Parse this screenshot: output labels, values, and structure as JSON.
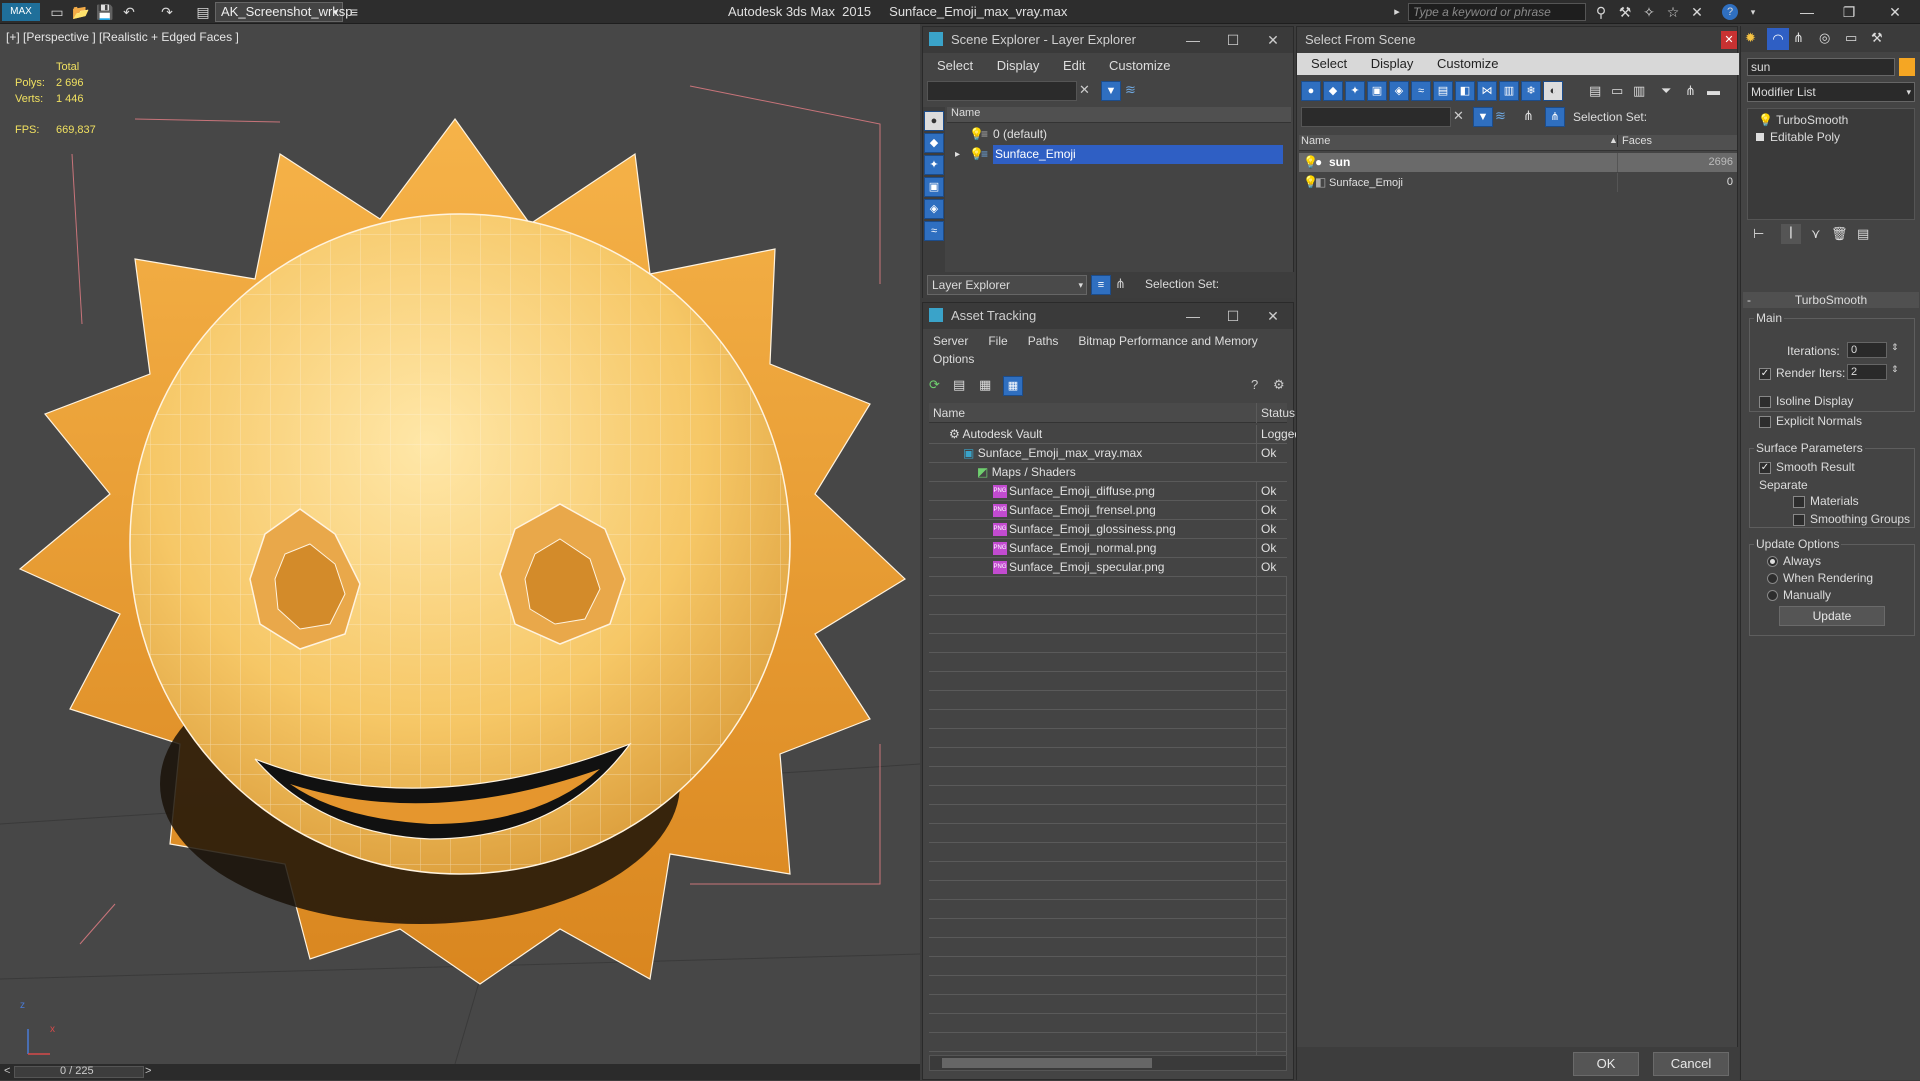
{
  "titlebar": {
    "workspace": "AK_Screenshot_wrksp",
    "app_title": "Autodesk 3ds Max  2015     Sunface_Emoji_max_vray.max",
    "search_placeholder": "Type a keyword or phrase"
  },
  "viewport": {
    "label": "[+] [Perspective ] [Realistic + Edged Faces ]",
    "stats": {
      "total_label": "Total",
      "polys_label": "Polys:",
      "polys_value": "2 696",
      "verts_label": "Verts:",
      "verts_value": "1 446",
      "fps_label": "FPS:",
      "fps_value": "669,837"
    },
    "axis_z": "z",
    "axis_x": "x"
  },
  "timeline": {
    "frame": "0 / 225"
  },
  "scene_explorer": {
    "title": "Scene Explorer - Layer Explorer",
    "menu": [
      "Select",
      "Display",
      "Edit",
      "Customize"
    ],
    "column_name": "Name",
    "layers": [
      {
        "name": "0 (default)",
        "selected": false
      },
      {
        "name": "Sunface_Emoji",
        "selected": true
      }
    ],
    "footer_dropdown": "Layer Explorer",
    "selection_set_label": "Selection Set:"
  },
  "asset_tracking": {
    "title": "Asset Tracking",
    "menu": [
      "Server",
      "File",
      "Paths",
      "Bitmap Performance and Memory"
    ],
    "menu2": "Options",
    "col_name": "Name",
    "col_status": "Status",
    "rows": [
      {
        "name": "Autodesk Vault",
        "status": "Logged",
        "indent": 1,
        "icon": "vault"
      },
      {
        "name": "Sunface_Emoji_max_vray.max",
        "status": "Ok",
        "indent": 2,
        "icon": "max"
      },
      {
        "name": "Maps / Shaders",
        "status": "",
        "indent": 3,
        "icon": "maps"
      },
      {
        "name": "Sunface_Emoji_diffuse.png",
        "status": "Ok",
        "indent": 4,
        "icon": "png"
      },
      {
        "name": "Sunface_Emoji_frensel.png",
        "status": "Ok",
        "indent": 4,
        "icon": "png"
      },
      {
        "name": "Sunface_Emoji_glossiness.png",
        "status": "Ok",
        "indent": 4,
        "icon": "png"
      },
      {
        "name": "Sunface_Emoji_normal.png",
        "status": "Ok",
        "indent": 4,
        "icon": "png"
      },
      {
        "name": "Sunface_Emoji_specular.png",
        "status": "Ok",
        "indent": 4,
        "icon": "png"
      }
    ],
    "png_badge": "PNG"
  },
  "select_from_scene": {
    "title": "Select From Scene",
    "menu": [
      "Select",
      "Display",
      "Customize"
    ],
    "selection_set_label": "Selection Set:",
    "col_name": "Name",
    "col_faces": "Faces",
    "rows": [
      {
        "name": "sun",
        "faces": "2696",
        "selected": true
      },
      {
        "name": "Sunface_Emoji",
        "faces": "0",
        "selected": false
      }
    ],
    "ok": "OK",
    "cancel": "Cancel"
  },
  "command_panel": {
    "object_name": "sun",
    "modifier_list": "Modifier List",
    "stack": [
      "TurboSmooth",
      "Editable Poly"
    ],
    "rollout_title": "TurboSmooth",
    "main_group": "Main",
    "iterations_label": "Iterations:",
    "iterations_value": "0",
    "render_iters_label": "Render Iters:",
    "render_iters_value": "2",
    "isoline_display": "Isoline Display",
    "explicit_normals": "Explicit Normals",
    "surface_group": "Surface Parameters",
    "smooth_result": "Smooth Result",
    "separate": "Separate",
    "materials": "Materials",
    "smoothing_groups": "Smoothing Groups",
    "update_group": "Update Options",
    "always": "Always",
    "when_rendering": "When Rendering",
    "manually": "Manually",
    "update_button": "Update",
    "colors": {
      "accent": "#f5a623",
      "selection": "#2f5fc4"
    }
  }
}
